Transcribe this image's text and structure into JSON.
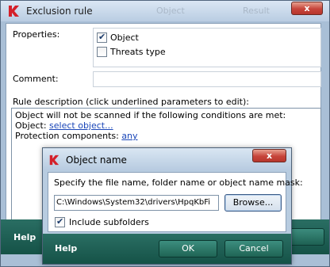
{
  "exclusion_rule": {
    "title": "Exclusion rule",
    "ghost_text_1": "Object",
    "ghost_text_2": "Result",
    "close_glyph": "x",
    "properties_label": "Properties:",
    "options": [
      {
        "label": "Object",
        "checked": true
      },
      {
        "label": "Threats type",
        "checked": false
      }
    ],
    "comment_label": "Comment:",
    "comment_value": "",
    "rule_description_label": "Rule description (click underlined parameters to edit):",
    "description": {
      "line1": "Object will not be scanned if the following conditions are met:",
      "object_prefix": "Object: ",
      "object_link": "select object...",
      "components_prefix": "Protection components: ",
      "components_link": "any"
    },
    "help_label": "Help",
    "cancel_partial": "ncel"
  },
  "object_name_dialog": {
    "title": "Object name",
    "close_glyph": "x",
    "instruction": "Specify the file name, folder name or object name mask:",
    "path_value": "C:\\Windows\\System32\\drivers\\HpqKbFi",
    "browse_label": "Browse...",
    "include_subfolders_label": "Include subfolders",
    "include_subfolders_checked": true,
    "help_label": "Help",
    "ok_label": "OK",
    "cancel_label": "Cancel"
  },
  "icons": {
    "app_logo": "kaspersky-k-icon",
    "check": "checkmark-icon"
  },
  "colors": {
    "footer_green": "#1d5f53",
    "close_red": "#c7453b",
    "link_blue": "#1a46b8",
    "logo_red": "#d4202a"
  }
}
